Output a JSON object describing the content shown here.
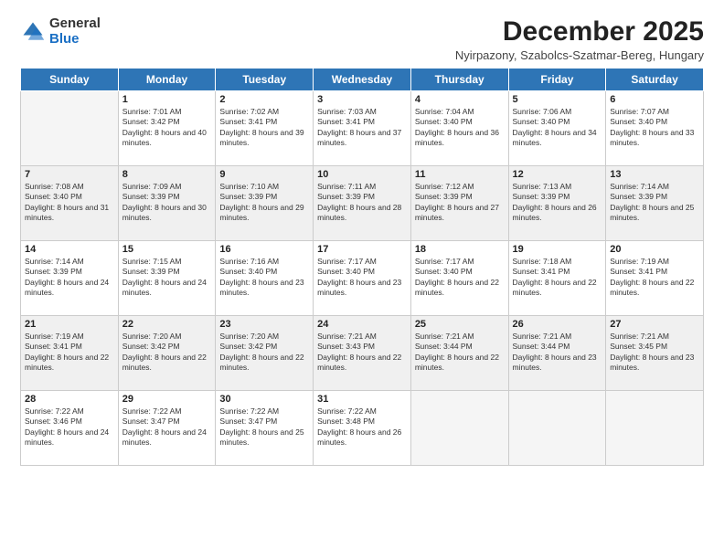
{
  "logo": {
    "general": "General",
    "blue": "Blue"
  },
  "title": "December 2025",
  "subtitle": "Nyirpazony, Szabolcs-Szatmar-Bereg, Hungary",
  "days_of_week": [
    "Sunday",
    "Monday",
    "Tuesday",
    "Wednesday",
    "Thursday",
    "Friday",
    "Saturday"
  ],
  "weeks": [
    [
      {
        "day": "",
        "empty": true
      },
      {
        "day": "1",
        "sunrise": "Sunrise: 7:01 AM",
        "sunset": "Sunset: 3:42 PM",
        "daylight": "Daylight: 8 hours and 40 minutes."
      },
      {
        "day": "2",
        "sunrise": "Sunrise: 7:02 AM",
        "sunset": "Sunset: 3:41 PM",
        "daylight": "Daylight: 8 hours and 39 minutes."
      },
      {
        "day": "3",
        "sunrise": "Sunrise: 7:03 AM",
        "sunset": "Sunset: 3:41 PM",
        "daylight": "Daylight: 8 hours and 37 minutes."
      },
      {
        "day": "4",
        "sunrise": "Sunrise: 7:04 AM",
        "sunset": "Sunset: 3:40 PM",
        "daylight": "Daylight: 8 hours and 36 minutes."
      },
      {
        "day": "5",
        "sunrise": "Sunrise: 7:06 AM",
        "sunset": "Sunset: 3:40 PM",
        "daylight": "Daylight: 8 hours and 34 minutes."
      },
      {
        "day": "6",
        "sunrise": "Sunrise: 7:07 AM",
        "sunset": "Sunset: 3:40 PM",
        "daylight": "Daylight: 8 hours and 33 minutes."
      }
    ],
    [
      {
        "day": "7",
        "sunrise": "Sunrise: 7:08 AM",
        "sunset": "Sunset: 3:40 PM",
        "daylight": "Daylight: 8 hours and 31 minutes.",
        "shaded": true
      },
      {
        "day": "8",
        "sunrise": "Sunrise: 7:09 AM",
        "sunset": "Sunset: 3:39 PM",
        "daylight": "Daylight: 8 hours and 30 minutes.",
        "shaded": true
      },
      {
        "day": "9",
        "sunrise": "Sunrise: 7:10 AM",
        "sunset": "Sunset: 3:39 PM",
        "daylight": "Daylight: 8 hours and 29 minutes.",
        "shaded": true
      },
      {
        "day": "10",
        "sunrise": "Sunrise: 7:11 AM",
        "sunset": "Sunset: 3:39 PM",
        "daylight": "Daylight: 8 hours and 28 minutes.",
        "shaded": true
      },
      {
        "day": "11",
        "sunrise": "Sunrise: 7:12 AM",
        "sunset": "Sunset: 3:39 PM",
        "daylight": "Daylight: 8 hours and 27 minutes.",
        "shaded": true
      },
      {
        "day": "12",
        "sunrise": "Sunrise: 7:13 AM",
        "sunset": "Sunset: 3:39 PM",
        "daylight": "Daylight: 8 hours and 26 minutes.",
        "shaded": true
      },
      {
        "day": "13",
        "sunrise": "Sunrise: 7:14 AM",
        "sunset": "Sunset: 3:39 PM",
        "daylight": "Daylight: 8 hours and 25 minutes.",
        "shaded": true
      }
    ],
    [
      {
        "day": "14",
        "sunrise": "Sunrise: 7:14 AM",
        "sunset": "Sunset: 3:39 PM",
        "daylight": "Daylight: 8 hours and 24 minutes."
      },
      {
        "day": "15",
        "sunrise": "Sunrise: 7:15 AM",
        "sunset": "Sunset: 3:39 PM",
        "daylight": "Daylight: 8 hours and 24 minutes."
      },
      {
        "day": "16",
        "sunrise": "Sunrise: 7:16 AM",
        "sunset": "Sunset: 3:40 PM",
        "daylight": "Daylight: 8 hours and 23 minutes."
      },
      {
        "day": "17",
        "sunrise": "Sunrise: 7:17 AM",
        "sunset": "Sunset: 3:40 PM",
        "daylight": "Daylight: 8 hours and 23 minutes."
      },
      {
        "day": "18",
        "sunrise": "Sunrise: 7:17 AM",
        "sunset": "Sunset: 3:40 PM",
        "daylight": "Daylight: 8 hours and 22 minutes."
      },
      {
        "day": "19",
        "sunrise": "Sunrise: 7:18 AM",
        "sunset": "Sunset: 3:41 PM",
        "daylight": "Daylight: 8 hours and 22 minutes."
      },
      {
        "day": "20",
        "sunrise": "Sunrise: 7:19 AM",
        "sunset": "Sunset: 3:41 PM",
        "daylight": "Daylight: 8 hours and 22 minutes."
      }
    ],
    [
      {
        "day": "21",
        "sunrise": "Sunrise: 7:19 AM",
        "sunset": "Sunset: 3:41 PM",
        "daylight": "Daylight: 8 hours and 22 minutes.",
        "shaded": true
      },
      {
        "day": "22",
        "sunrise": "Sunrise: 7:20 AM",
        "sunset": "Sunset: 3:42 PM",
        "daylight": "Daylight: 8 hours and 22 minutes.",
        "shaded": true
      },
      {
        "day": "23",
        "sunrise": "Sunrise: 7:20 AM",
        "sunset": "Sunset: 3:42 PM",
        "daylight": "Daylight: 8 hours and 22 minutes.",
        "shaded": true
      },
      {
        "day": "24",
        "sunrise": "Sunrise: 7:21 AM",
        "sunset": "Sunset: 3:43 PM",
        "daylight": "Daylight: 8 hours and 22 minutes.",
        "shaded": true
      },
      {
        "day": "25",
        "sunrise": "Sunrise: 7:21 AM",
        "sunset": "Sunset: 3:44 PM",
        "daylight": "Daylight: 8 hours and 22 minutes.",
        "shaded": true
      },
      {
        "day": "26",
        "sunrise": "Sunrise: 7:21 AM",
        "sunset": "Sunset: 3:44 PM",
        "daylight": "Daylight: 8 hours and 23 minutes.",
        "shaded": true
      },
      {
        "day": "27",
        "sunrise": "Sunrise: 7:21 AM",
        "sunset": "Sunset: 3:45 PM",
        "daylight": "Daylight: 8 hours and 23 minutes.",
        "shaded": true
      }
    ],
    [
      {
        "day": "28",
        "sunrise": "Sunrise: 7:22 AM",
        "sunset": "Sunset: 3:46 PM",
        "daylight": "Daylight: 8 hours and 24 minutes."
      },
      {
        "day": "29",
        "sunrise": "Sunrise: 7:22 AM",
        "sunset": "Sunset: 3:47 PM",
        "daylight": "Daylight: 8 hours and 24 minutes."
      },
      {
        "day": "30",
        "sunrise": "Sunrise: 7:22 AM",
        "sunset": "Sunset: 3:47 PM",
        "daylight": "Daylight: 8 hours and 25 minutes."
      },
      {
        "day": "31",
        "sunrise": "Sunrise: 7:22 AM",
        "sunset": "Sunset: 3:48 PM",
        "daylight": "Daylight: 8 hours and 26 minutes."
      },
      {
        "day": "",
        "empty": true
      },
      {
        "day": "",
        "empty": true
      },
      {
        "day": "",
        "empty": true
      }
    ]
  ]
}
